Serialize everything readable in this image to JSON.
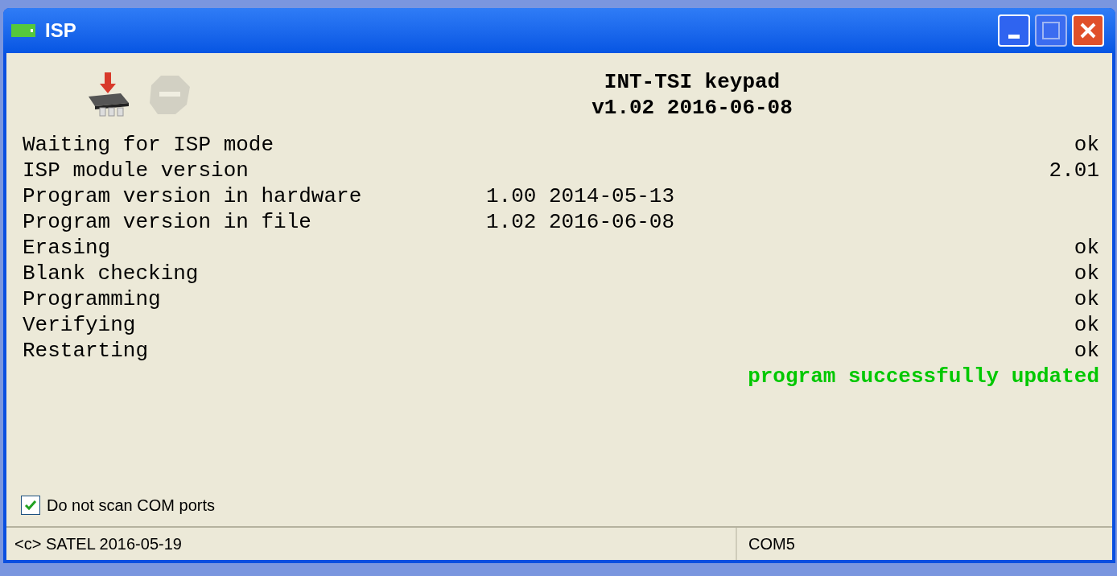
{
  "window": {
    "title": "ISP"
  },
  "toolbar": [
    {
      "kind": "program",
      "disabled": false
    },
    {
      "kind": "stop",
      "disabled": true
    }
  ],
  "header": {
    "device": "INT-TSI keypad",
    "version": "v1.02 2016-06-08"
  },
  "steps": [
    {
      "label": "Waiting for ISP mode",
      "result": "ok"
    },
    {
      "label": "ISP module version",
      "result": "2.01"
    },
    {
      "label": "Program version in hardware",
      "detail": "1.00 2014-05-13"
    },
    {
      "label": "Program version in file",
      "detail": "1.02 2016-06-08"
    },
    {
      "label": "Erasing",
      "result": "ok"
    },
    {
      "label": "Blank checking",
      "result": "ok"
    },
    {
      "label": "Programming",
      "result": "ok"
    },
    {
      "label": "Verifying",
      "result": "ok"
    },
    {
      "label": "Restarting",
      "result": "ok"
    }
  ],
  "message": "program successfully updated",
  "option": {
    "label": "Do not scan COM ports",
    "checked": true
  },
  "status_bar": [
    "<c> SATEL 2016-05-19",
    "COM5"
  ]
}
